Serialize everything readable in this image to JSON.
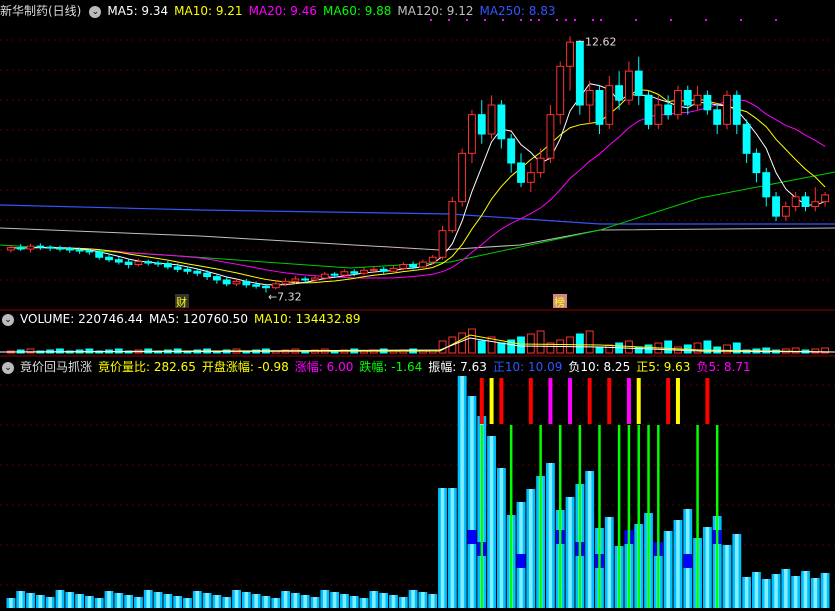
{
  "panels": {
    "price": {
      "title": "新华制药(日线)",
      "ma": [
        {
          "label": "MA5: 9.34",
          "color": "#ffffff"
        },
        {
          "label": "MA10: 9.21",
          "color": "#ffff00"
        },
        {
          "label": "MA20: 9.46",
          "color": "#ff00ff"
        },
        {
          "label": "MA60: 9.88",
          "color": "#00ff00"
        },
        {
          "label": "MA120: 9.12",
          "color": "#c0c0c0"
        },
        {
          "label": "MA250: 8.83",
          "color": "#3355ff"
        }
      ],
      "high_label": "12.62",
      "low_label": "7.32",
      "marker_cai": "财",
      "marker_bang": "榜"
    },
    "volume": {
      "items": [
        {
          "label": "VOLUME: 220746.44",
          "color": "#ffffff"
        },
        {
          "label": "MA5: 120760.50",
          "color": "#ffffff"
        },
        {
          "label": "MA10: 134432.89",
          "color": "#ffff00"
        }
      ]
    },
    "indicator": {
      "name": "竟价回马抓涨",
      "items": [
        {
          "label": "竟价量比: 282.65",
          "color": "#ffff00"
        },
        {
          "label": "开盘涨幅: -0.98",
          "color": "#ffff00"
        },
        {
          "label": "涨幅: 6.00",
          "color": "#ff00ff"
        },
        {
          "label": "跌幅: -1.64",
          "color": "#00ff00"
        },
        {
          "label": "振幅: 7.63",
          "color": "#ffffff"
        },
        {
          "label": "正10: 10.09",
          "color": "#3355ff"
        },
        {
          "label": "负10: 8.25",
          "color": "#ffffff"
        },
        {
          "label": "正5: 9.63",
          "color": "#ffff00"
        },
        {
          "label": "负5: 8.71",
          "color": "#ff00ff"
        }
      ]
    }
  },
  "chart_data": {
    "type": "candlestick",
    "price_range": [
      7.0,
      13.0
    ],
    "candles": [
      [
        8.2,
        8.25,
        8.15,
        8.3
      ],
      [
        8.25,
        8.22,
        8.18,
        8.32
      ],
      [
        8.22,
        8.28,
        8.15,
        8.33
      ],
      [
        8.28,
        8.26,
        8.2,
        8.34
      ],
      [
        8.26,
        8.24,
        8.18,
        8.3
      ],
      [
        8.24,
        8.23,
        8.17,
        8.29
      ],
      [
        8.23,
        8.2,
        8.14,
        8.27
      ],
      [
        8.2,
        8.18,
        8.12,
        8.25
      ],
      [
        8.18,
        8.16,
        8.1,
        8.23
      ],
      [
        8.16,
        8.05,
        8.0,
        8.2
      ],
      [
        8.05,
        8.0,
        7.95,
        8.1
      ],
      [
        8.0,
        7.95,
        7.9,
        8.06
      ],
      [
        7.95,
        7.9,
        7.82,
        8.0
      ],
      [
        7.9,
        7.96,
        7.86,
        8.02
      ],
      [
        7.96,
        7.93,
        7.88,
        8.0
      ],
      [
        7.93,
        7.92,
        7.85,
        7.98
      ],
      [
        7.92,
        7.85,
        7.8,
        7.97
      ],
      [
        7.85,
        7.8,
        7.74,
        7.92
      ],
      [
        7.8,
        7.76,
        7.7,
        7.86
      ],
      [
        7.76,
        7.72,
        7.66,
        7.82
      ],
      [
        7.72,
        7.65,
        7.58,
        7.78
      ],
      [
        7.65,
        7.58,
        7.5,
        7.7
      ],
      [
        7.58,
        7.5,
        7.45,
        7.64
      ],
      [
        7.5,
        7.55,
        7.45,
        7.6
      ],
      [
        7.55,
        7.48,
        7.42,
        7.6
      ],
      [
        7.48,
        7.45,
        7.4,
        7.55
      ],
      [
        7.45,
        7.42,
        7.32,
        7.5
      ],
      [
        7.42,
        7.5,
        7.38,
        7.56
      ],
      [
        7.5,
        7.55,
        7.46,
        7.62
      ],
      [
        7.55,
        7.6,
        7.5,
        7.66
      ],
      [
        7.6,
        7.58,
        7.52,
        7.65
      ],
      [
        7.58,
        7.62,
        7.54,
        7.68
      ],
      [
        7.62,
        7.7,
        7.58,
        7.75
      ],
      [
        7.7,
        7.68,
        7.62,
        7.74
      ],
      [
        7.68,
        7.75,
        7.64,
        7.8
      ],
      [
        7.75,
        7.72,
        7.66,
        7.8
      ],
      [
        7.72,
        7.78,
        7.68,
        7.84
      ],
      [
        7.78,
        7.8,
        7.72,
        7.86
      ],
      [
        7.8,
        7.76,
        7.7,
        7.85
      ],
      [
        7.76,
        7.82,
        7.72,
        7.88
      ],
      [
        7.82,
        7.9,
        7.78,
        7.95
      ],
      [
        7.9,
        7.85,
        7.8,
        7.96
      ],
      [
        7.85,
        7.95,
        7.82,
        8.0
      ],
      [
        7.95,
        8.05,
        7.9,
        8.1
      ],
      [
        8.05,
        8.6,
        8.0,
        8.7
      ],
      [
        8.6,
        9.2,
        8.55,
        9.3
      ],
      [
        9.2,
        10.2,
        9.1,
        10.3
      ],
      [
        10.2,
        11.0,
        10.0,
        11.1
      ],
      [
        11.0,
        10.6,
        10.4,
        11.3
      ],
      [
        10.6,
        11.2,
        10.5,
        11.4
      ],
      [
        11.2,
        10.5,
        10.3,
        11.3
      ],
      [
        10.5,
        10.0,
        9.8,
        10.6
      ],
      [
        10.0,
        9.6,
        9.5,
        10.2
      ],
      [
        9.6,
        9.8,
        9.4,
        10.0
      ],
      [
        9.8,
        10.1,
        9.7,
        10.3
      ],
      [
        10.1,
        11.0,
        10.0,
        11.2
      ],
      [
        11.0,
        12.0,
        10.8,
        12.1
      ],
      [
        12.0,
        12.5,
        11.5,
        12.62
      ],
      [
        12.5,
        11.2,
        11.0,
        12.55
      ],
      [
        11.2,
        11.5,
        10.8,
        11.7
      ],
      [
        11.5,
        10.8,
        10.6,
        11.6
      ],
      [
        10.8,
        11.6,
        10.7,
        11.8
      ],
      [
        11.6,
        11.3,
        11.1,
        11.9
      ],
      [
        11.3,
        11.9,
        11.2,
        12.1
      ],
      [
        11.9,
        11.4,
        11.2,
        12.2
      ],
      [
        11.4,
        10.8,
        10.7,
        11.5
      ],
      [
        10.8,
        11.2,
        10.7,
        11.4
      ],
      [
        11.2,
        11.0,
        10.9,
        11.4
      ],
      [
        11.0,
        11.5,
        10.9,
        11.6
      ],
      [
        11.5,
        11.2,
        11.0,
        11.6
      ],
      [
        11.2,
        11.4,
        11.1,
        11.6
      ],
      [
        11.4,
        11.1,
        11.0,
        11.5
      ],
      [
        11.1,
        10.8,
        10.6,
        11.2
      ],
      [
        10.8,
        11.4,
        10.7,
        11.5
      ],
      [
        11.4,
        10.8,
        10.6,
        11.5
      ],
      [
        10.8,
        10.2,
        10.0,
        10.9
      ],
      [
        10.2,
        9.8,
        9.6,
        10.3
      ],
      [
        9.8,
        9.3,
        9.1,
        9.9
      ],
      [
        9.3,
        8.9,
        8.8,
        9.4
      ],
      [
        8.9,
        9.1,
        8.8,
        9.2
      ],
      [
        9.1,
        9.3,
        9.0,
        9.4
      ],
      [
        9.3,
        9.1,
        9.0,
        9.4
      ],
      [
        9.1,
        9.2,
        9.0,
        9.5
      ],
      [
        9.2,
        9.34,
        9.1,
        9.4
      ]
    ],
    "high": 12.62,
    "low": 7.32
  }
}
